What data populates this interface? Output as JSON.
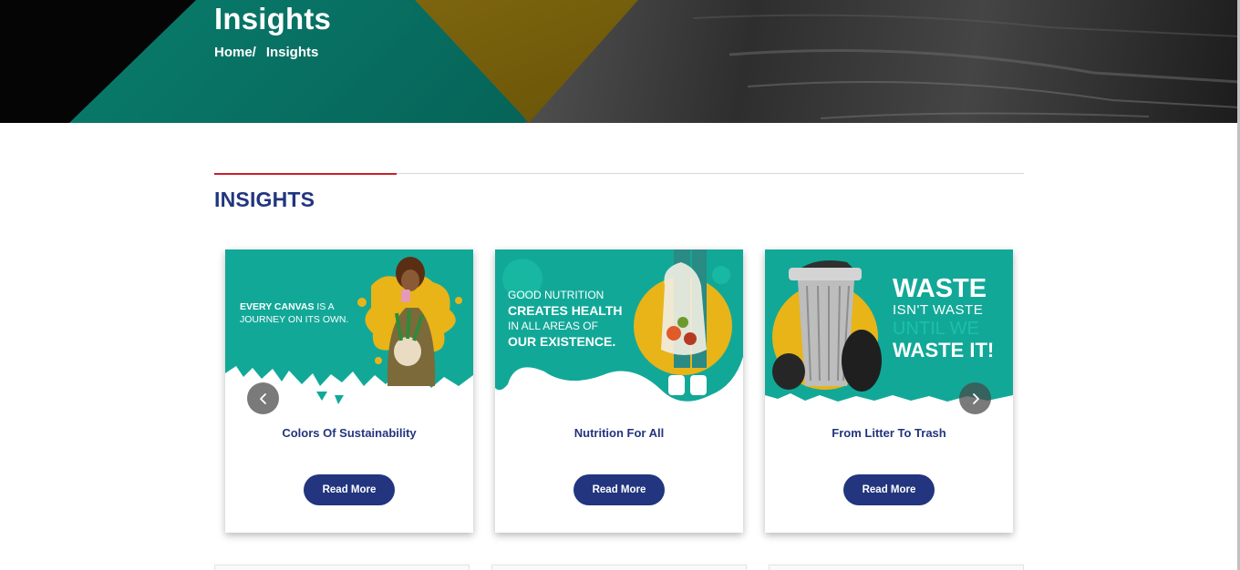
{
  "hero": {
    "title": "Insights",
    "breadcrumb": {
      "home": "Home/",
      "current": "Insights"
    }
  },
  "section": {
    "title": "INSIGHTS",
    "accent_color": "#c8202b",
    "title_color": "#22357e"
  },
  "cards": [
    {
      "title": "Colors Of Sustainability",
      "button": "Read More",
      "image_text": {
        "line1_bold": "EVERY CANVAS",
        "line1_rest": " IS A",
        "line2": "JOURNEY ON ITS OWN."
      }
    },
    {
      "title": "Nutrition For All",
      "button": "Read More",
      "image_text": {
        "line1": "GOOD NUTRITION",
        "line2": "CREATES HEALTH",
        "line3": "IN ALL AREAS OF",
        "line4": "OUR EXISTENCE."
      }
    },
    {
      "title": "From Litter To Trash",
      "button": "Read More",
      "image_text": {
        "line1": "WASTE",
        "line2": "ISN'T WASTE",
        "line3": "UNTIL WE",
        "line4": "WASTE IT!"
      }
    }
  ],
  "carousel": {
    "prev_icon": "chevron-left-icon",
    "next_icon": "chevron-right-icon"
  },
  "colors": {
    "teal": "#12a898",
    "navy": "#22357e",
    "gold": "#e8b418"
  }
}
